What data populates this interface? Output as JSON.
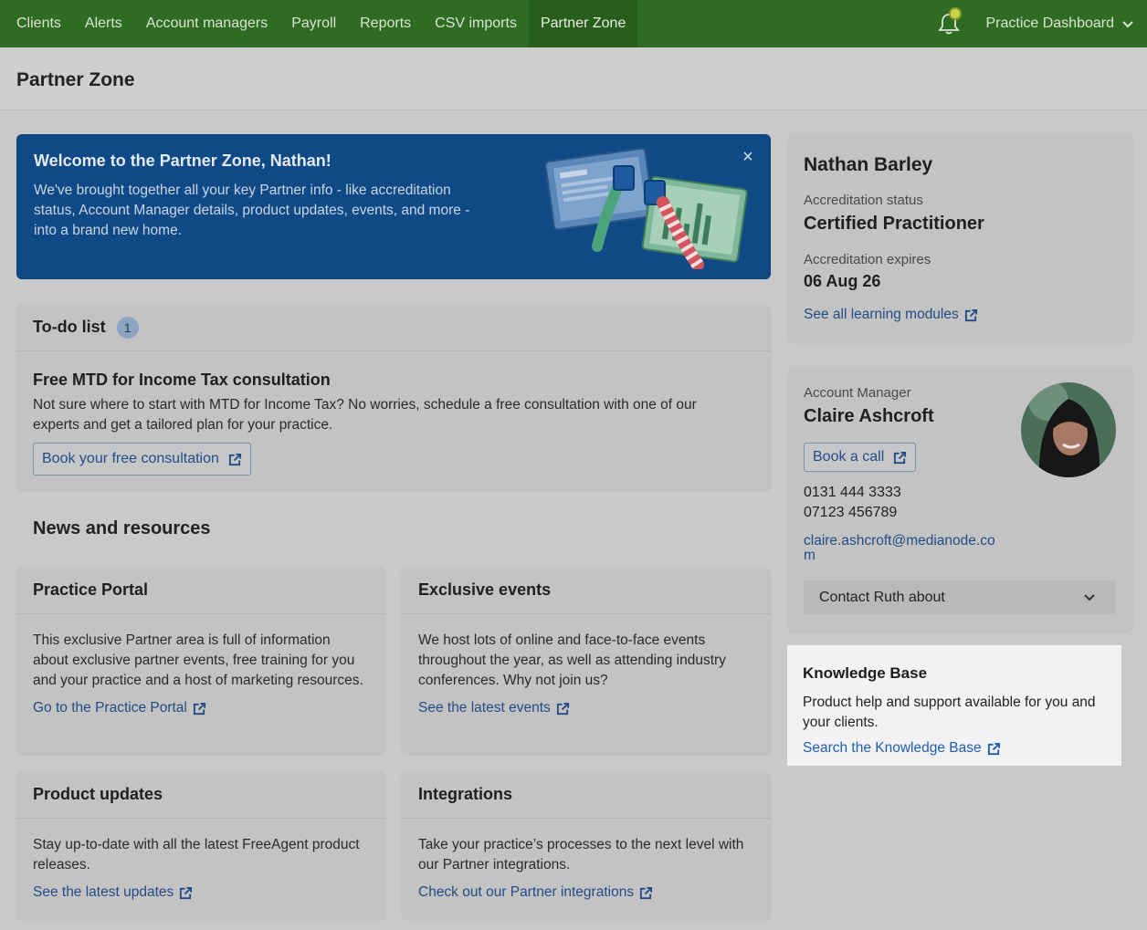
{
  "nav": {
    "items": [
      "Clients",
      "Alerts",
      "Account managers",
      "Payroll",
      "Reports",
      "CSV imports",
      "Partner Zone"
    ],
    "active": "Partner Zone",
    "dashboard": "Practice Dashboard"
  },
  "page": {
    "title": "Partner Zone"
  },
  "banner": {
    "title": "Welcome to the Partner Zone, Nathan!",
    "text": "We've brought together all your key Partner info - like accreditation status, Account Manager details, product updates, events, and more - into a brand new home.",
    "close": "×"
  },
  "todo": {
    "title": "To-do list",
    "count": "1",
    "item_title": "Free MTD for Income Tax consultation",
    "item_text": "Not sure where to start with MTD for Income Tax? No worries, schedule a free consultation with one of our experts and get a tailored plan for your practice.",
    "button": "Book your free consultation"
  },
  "news": {
    "title": "News and resources"
  },
  "cards": {
    "portal": {
      "title": "Practice Portal",
      "text": "This exclusive Partner area is full of information about exclusive partner events, free training for you and your practice and a host of marketing resources.",
      "link": "Go to the Practice Portal"
    },
    "events": {
      "title": "Exclusive events",
      "text": "We host lots of online and face-to-face events throughout the year, as well as attending industry conferences. Why not join us?",
      "link": "See the latest events"
    },
    "updates": {
      "title": "Product updates",
      "text": "Stay up-to-date with all the latest FreeAgent product releases.",
      "link": "See the latest updates"
    },
    "integrations": {
      "title": "Integrations",
      "text": "Take your practice’s processes to the next level with our Partner integrations.",
      "link": "Check out our Partner integrations"
    }
  },
  "profile": {
    "name": "Nathan Barley",
    "status_label": "Accreditation status",
    "status": "Certified Practitioner",
    "expires_label": "Accreditation expires",
    "expires": "06 Aug 26",
    "link": "See all learning modules"
  },
  "manager": {
    "label": "Account Manager",
    "name": "Claire Ashcroft",
    "button": "Book a call",
    "phone1": "0131 444 3333",
    "phone2": "07123 456789",
    "email_line1": "claire.ashcroft@medianode.co",
    "email_line2": "m",
    "dropdown": "Contact Ruth about"
  },
  "kb": {
    "title": "Knowledge Base",
    "text": "Product help and support available for you and your clients.",
    "link": "Search the Knowledge Base"
  },
  "colors": {
    "nav": "#2f6b22",
    "banner": "#0f4a87",
    "link": "#234c86",
    "kb_link": "#1f5fb0"
  }
}
